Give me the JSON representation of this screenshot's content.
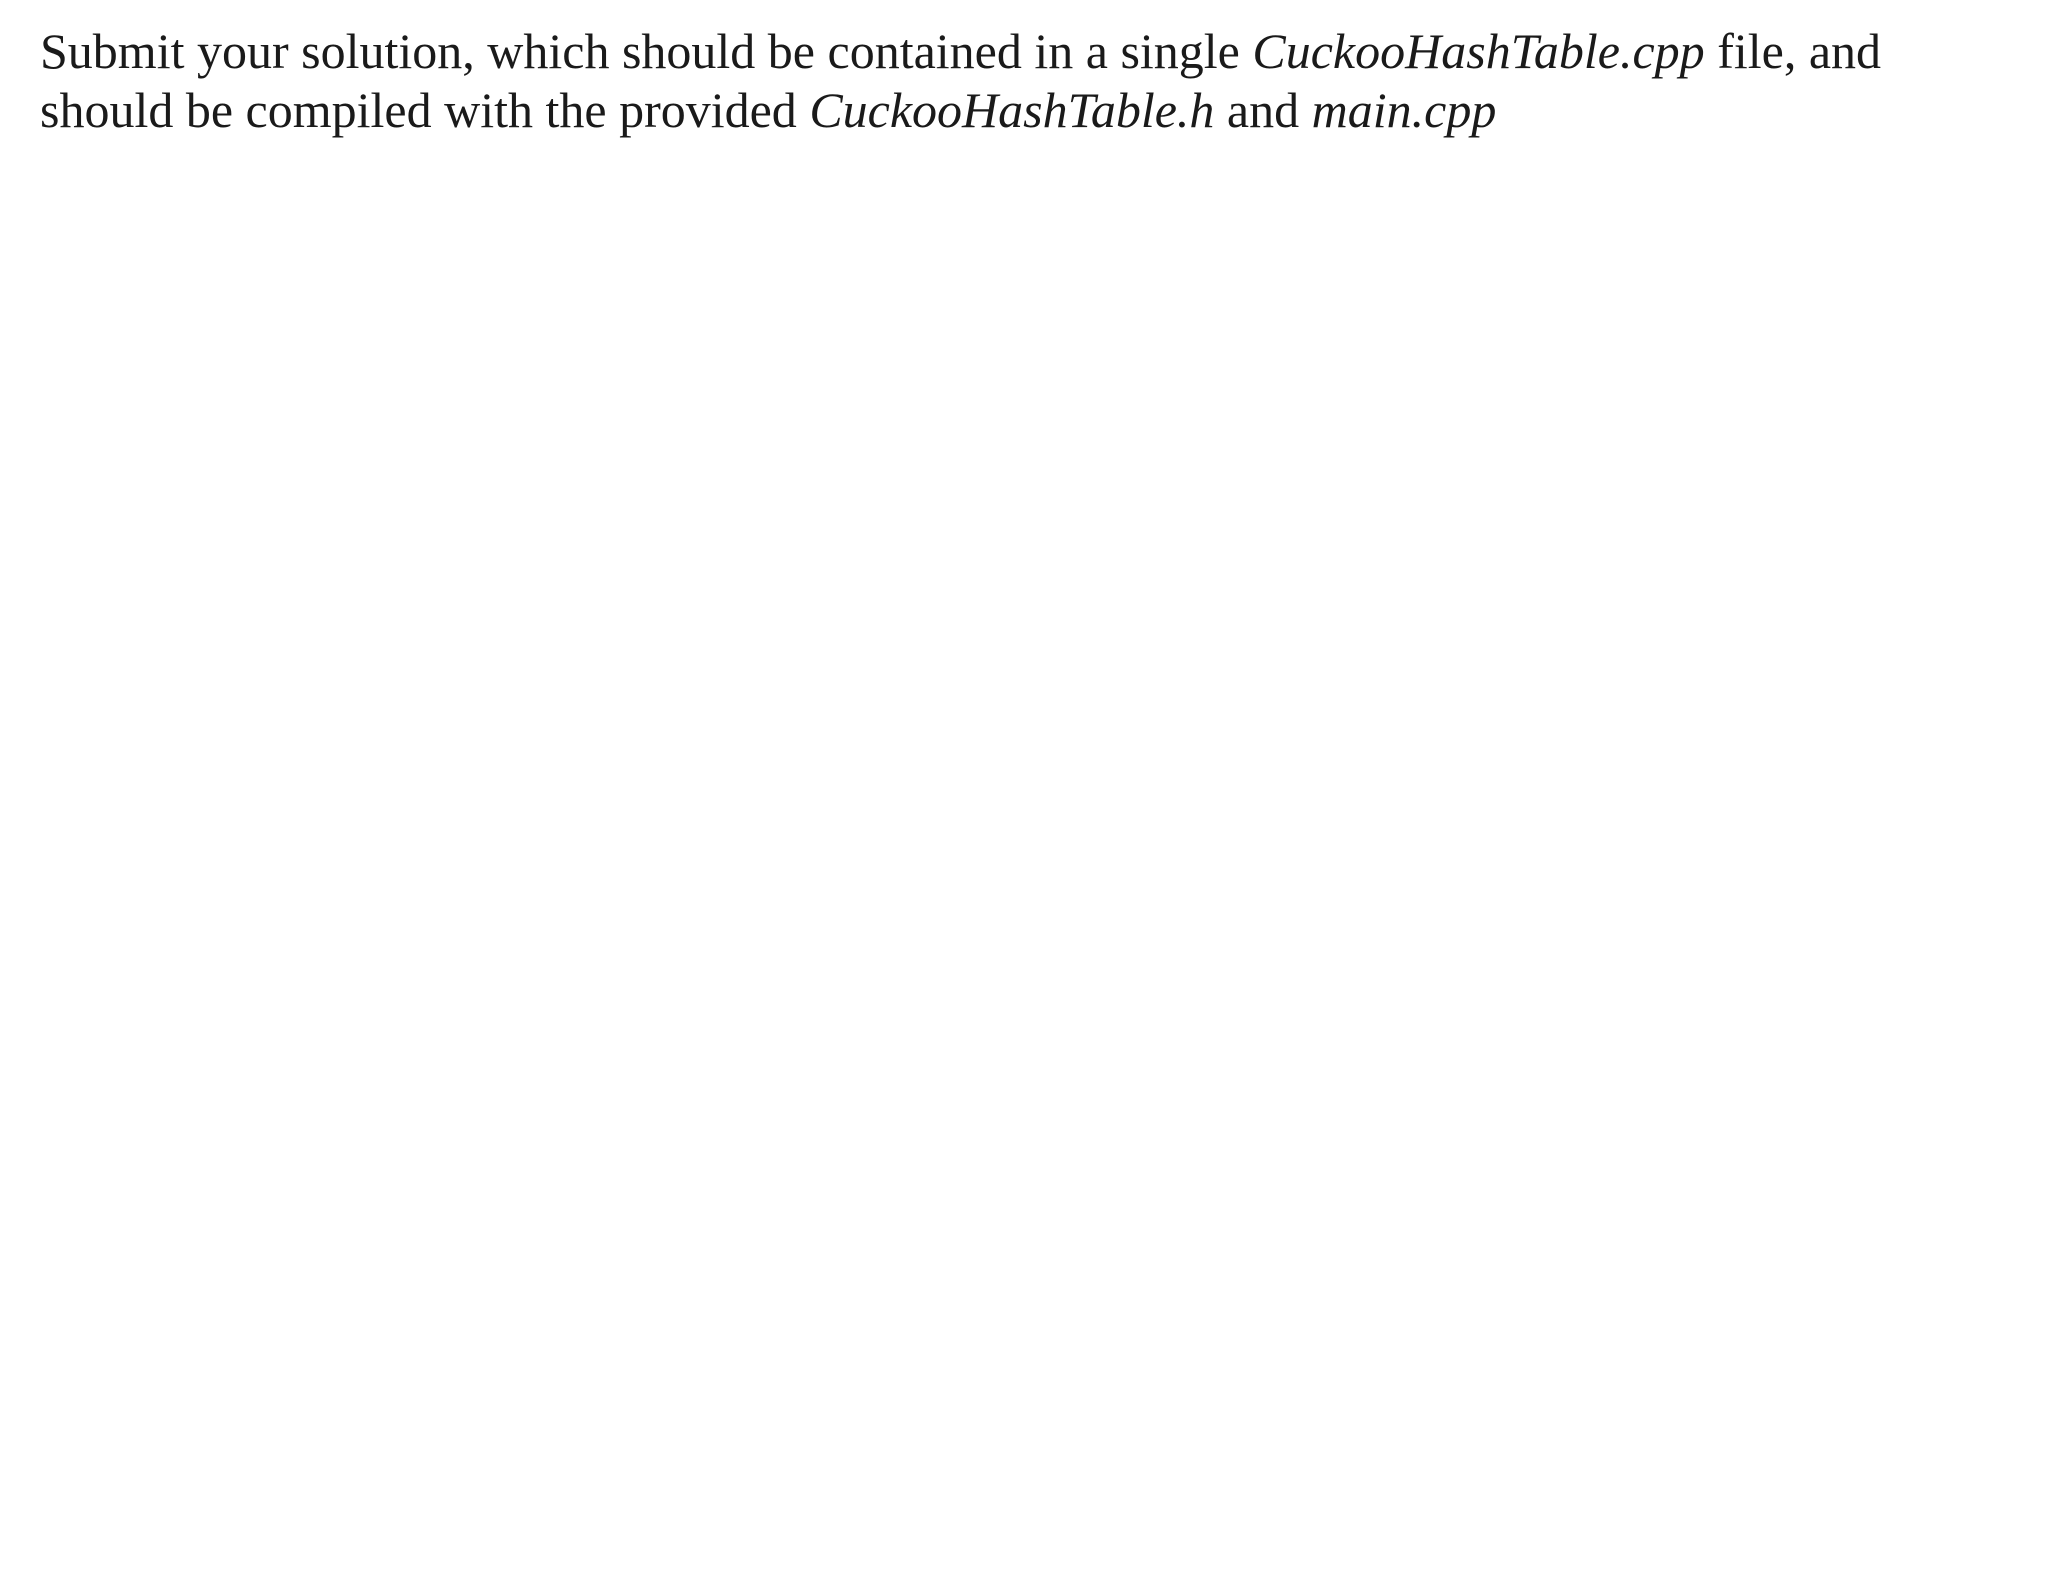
{
  "document": {
    "paragraph": {
      "text_part_1": "Submit your solution, which should be contained in a single ",
      "italic_1": "CuckooHashTable.cpp",
      "text_part_2": " file, and should be compiled with the provided ",
      "italic_2": "CuckooHashTable.h",
      "text_part_3": " and ",
      "italic_3": "main.cpp"
    }
  }
}
